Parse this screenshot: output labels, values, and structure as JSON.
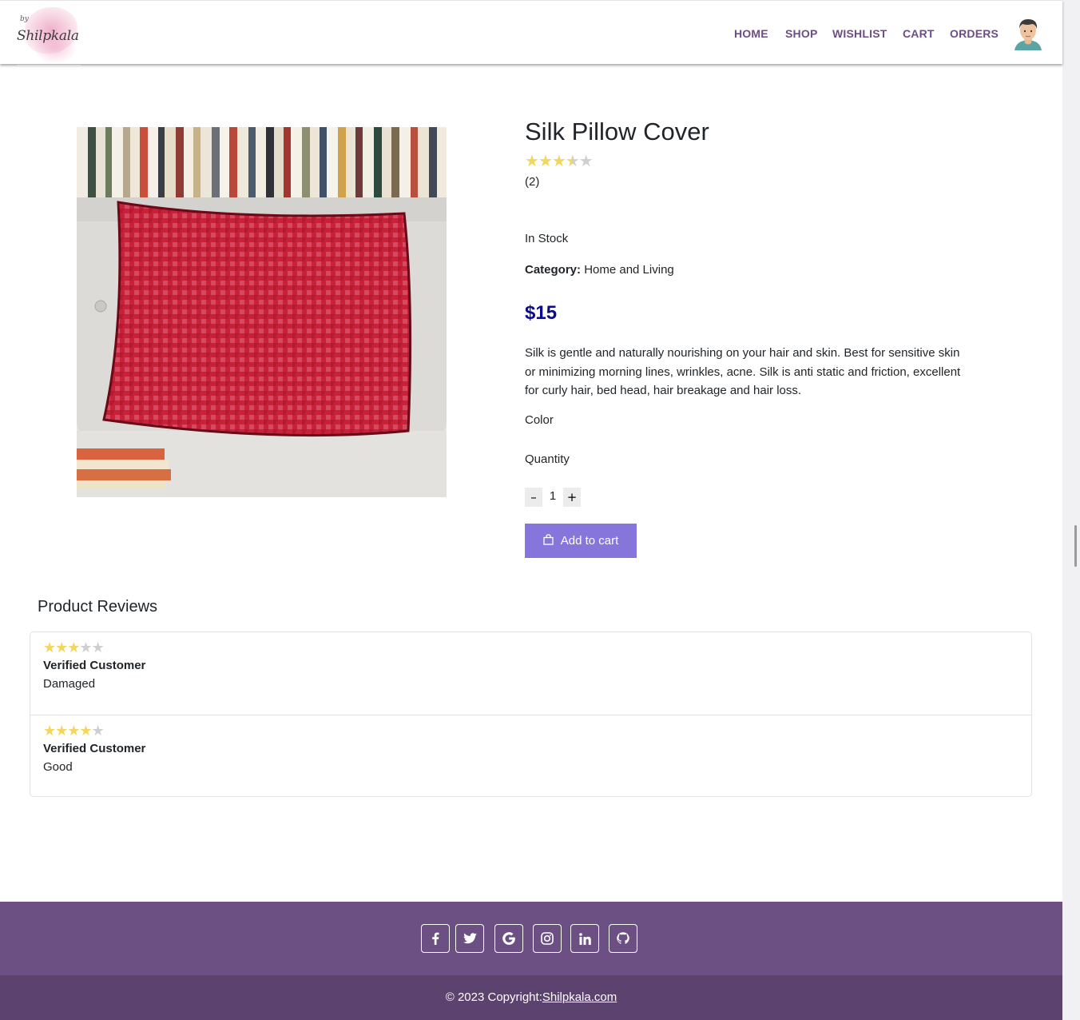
{
  "brand": {
    "logo_by": "by",
    "logo_name": "Shilpkala"
  },
  "nav": {
    "home": "HOME",
    "shop": "SHOP",
    "wishlist": "WISHLIST",
    "cart": "CART",
    "orders": "ORDERS",
    "avatar_icon": "user-avatar-icon"
  },
  "product": {
    "title": "Silk Pillow Cover",
    "rating": 3.5,
    "rating_max": 5,
    "rating_count": "(2)",
    "stock": "In Stock",
    "category_label": "Category:",
    "category_value": "Home and Living",
    "price": "$15",
    "description": "Silk is gentle and naturally nourishing on your hair and skin. Best for sensitive skin or minimizing morning lines, wrinkles, acne. Silk is anti static and friction, excellent for curly hair, bed head, hair breakage and hair loss.",
    "color_label": "Color",
    "quantity_label": "Quantity",
    "quantity_minus": "–",
    "quantity_value": "1",
    "quantity_plus": "+",
    "add_to_cart": "Add to cart",
    "add_to_cart_icon": "shopping-bag-icon"
  },
  "reviews": {
    "heading": "Product Reviews",
    "items": [
      {
        "rating": 3,
        "author": "Verified Customer",
        "text": "Damaged"
      },
      {
        "rating": 4,
        "author": "Verified Customer",
        "text": "Good"
      }
    ]
  },
  "footer": {
    "social_icons": [
      "facebook-icon",
      "twitter-icon",
      "google-icon",
      "instagram-icon",
      "linkedin-icon",
      "github-icon"
    ],
    "copyright": "© 2023 Copyright:",
    "site_link": "Shilpkala.com"
  },
  "colors": {
    "nav_link": "#6d4e84",
    "price": "#0c0c8a",
    "add_to_cart_bg": "#8676dc",
    "footer_top": "#6d5083",
    "footer_bottom": "#5c426f",
    "star_on": "#f2d65f",
    "star_off": "#cfcfcf"
  }
}
